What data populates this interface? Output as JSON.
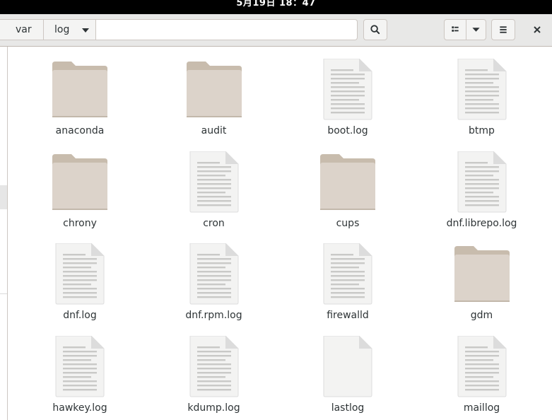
{
  "topbar": {
    "clock": "5月19日 18：47"
  },
  "pathbar": {
    "crumbs": [
      {
        "label": "var"
      },
      {
        "label": "log"
      }
    ]
  },
  "toolbar": {
    "search_icon": "search-icon",
    "view_icon": "list-view-icon",
    "view_menu_icon": "chevron-down-icon",
    "menu_icon": "hamburger-menu-icon",
    "close_icon": "close-icon"
  },
  "colors": {
    "folder_body": "#dcd3ca",
    "folder_tab": "#c8bcad",
    "doc_body": "#f3f3f2",
    "doc_lines": "#c9c9c7"
  },
  "files": [
    {
      "name": "anaconda",
      "type": "folder"
    },
    {
      "name": "audit",
      "type": "folder"
    },
    {
      "name": "boot.log",
      "type": "text"
    },
    {
      "name": "btmp",
      "type": "text"
    },
    {
      "name": "chrony",
      "type": "folder"
    },
    {
      "name": "cron",
      "type": "text"
    },
    {
      "name": "cups",
      "type": "folder"
    },
    {
      "name": "dnf.librepo.log",
      "type": "text"
    },
    {
      "name": "dnf.log",
      "type": "text"
    },
    {
      "name": "dnf.rpm.log",
      "type": "text"
    },
    {
      "name": "firewalld",
      "type": "text"
    },
    {
      "name": "gdm",
      "type": "folder"
    },
    {
      "name": "hawkey.log",
      "type": "text"
    },
    {
      "name": "kdump.log",
      "type": "text"
    },
    {
      "name": "lastlog",
      "type": "blank"
    },
    {
      "name": "maillog",
      "type": "text"
    }
  ]
}
